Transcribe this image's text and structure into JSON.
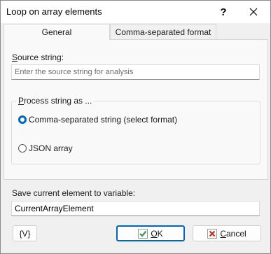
{
  "window": {
    "title": "Loop on array elements",
    "help_label": "?"
  },
  "tabs": [
    {
      "label": "General",
      "active": true
    },
    {
      "label": "Comma-separated format",
      "active": false
    }
  ],
  "source": {
    "label_first": "S",
    "label_rest": "ource string:",
    "value": "",
    "placeholder": "Enter the source string for analysis"
  },
  "process": {
    "label_first": "P",
    "label_rest": "rocess string as ...",
    "options": [
      {
        "label": "Comma-separated string (select format)",
        "selected": true
      },
      {
        "label": "JSON array",
        "selected": false
      }
    ]
  },
  "save": {
    "label": "Save current element to variable:",
    "value": "CurrentArrayElement"
  },
  "buttons": {
    "variable": "{V}",
    "ok_first": "O",
    "ok_rest": "K",
    "cancel_first": "C",
    "cancel_rest": "ancel"
  },
  "colors": {
    "accent": "#0067c0",
    "ok_check": "#2e9e3e",
    "cancel_x": "#c42b1c"
  },
  "icons": [
    "close-icon",
    "check-icon",
    "cancel-icon"
  ]
}
